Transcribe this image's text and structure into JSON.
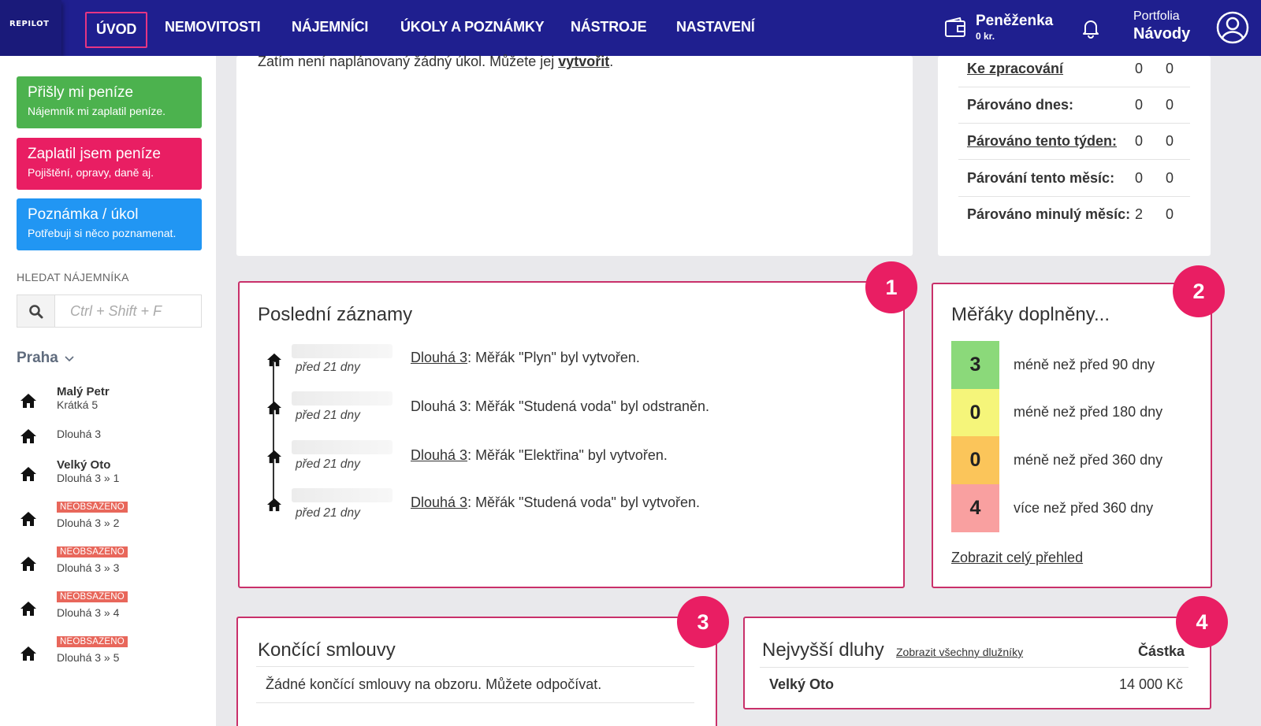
{
  "nav": {
    "logo": "REPILOT",
    "items": [
      "ÚVOD",
      "NEMOVITOSTI",
      "NÁJEMNÍCI",
      "ÚKOLY A POZNÁMKY",
      "NÁSTROJE",
      "NASTAVENÍ"
    ],
    "wallet_label": "Peněženka",
    "wallet_amount": "0 kr.",
    "portfolio_label": "Portfolia",
    "guides_label": "Návody"
  },
  "sidebar": {
    "actions": [
      {
        "title": "Přišly mi peníze",
        "subtitle": "Nájemník mi zaplatil peníze.",
        "color": "#4cb24e"
      },
      {
        "title": "Zaplatil jsem peníze",
        "subtitle": "Pojištění, opravy, daně aj.",
        "color": "#e91e63"
      },
      {
        "title": "Poznámka / úkol",
        "subtitle": "Potřebuji si něco poznamenat.",
        "color": "#2196f3"
      }
    ],
    "search_label": "HLEDAT NÁJEMNÍKA",
    "search_placeholder": "Ctrl + Shift + F",
    "city": "Praha",
    "tenants": [
      {
        "name": "Malý Petr",
        "address": "Krátká 5",
        "badge": ""
      },
      {
        "name": "",
        "address": "Dlouhá 3",
        "badge": ""
      },
      {
        "name": "Velký Oto",
        "address": "Dlouhá 3 » 1",
        "badge": ""
      },
      {
        "name": "",
        "address": "Dlouhá 3 » 2",
        "badge": "NEOBSAZENO"
      },
      {
        "name": "",
        "address": "Dlouhá 3 » 3",
        "badge": "NEOBSAZENO"
      },
      {
        "name": "",
        "address": "Dlouhá 3 » 4",
        "badge": "NEOBSAZENO"
      },
      {
        "name": "",
        "address": "Dlouhá 3 » 5",
        "badge": "NEOBSAZENO"
      }
    ]
  },
  "tasks": {
    "text": "Zatím není naplánovaný žádný úkol. Můžete jej ",
    "link": "vytvořit",
    "end": "."
  },
  "stats": [
    {
      "label": "Ke zpracování",
      "v1": "0",
      "v2": "0",
      "link": true
    },
    {
      "label": "Párováno dnes:",
      "v1": "0",
      "v2": "0",
      "link": false
    },
    {
      "label": "Párováno tento týden:",
      "v1": "0",
      "v2": "0",
      "link": true
    },
    {
      "label": "Párování tento měsíc:",
      "v1": "0",
      "v2": "0",
      "link": false
    },
    {
      "label": "Párováno minulý měsíc:",
      "v1": "2",
      "v2": "0",
      "link": false
    }
  ],
  "recent": {
    "number": "1",
    "title": "Poslední záznamy",
    "items": [
      {
        "date": "před 21 dny",
        "link": "Dlouhá 3",
        "text": ": Měřák \"Plyn\" byl vytvořen."
      },
      {
        "date": "před 21 dny",
        "link": "",
        "text": "Dlouhá 3: Měřák \"Studená voda\" byl odstraněn."
      },
      {
        "date": "před 21 dny",
        "link": "Dlouhá 3",
        "text": ": Měřák \"Elektřina\" byl vytvořen."
      },
      {
        "date": "před 21 dny",
        "link": "Dlouhá 3",
        "text": ": Měřák \"Studená voda\" byl vytvořen."
      }
    ]
  },
  "meters": {
    "number": "2",
    "title": "Měřáky doplněny...",
    "rows": [
      {
        "count": "3",
        "label": "méně než před 90 dny",
        "color": "#8bd97a"
      },
      {
        "count": "0",
        "label": "méně než před 180 dny",
        "color": "#f5f57a"
      },
      {
        "count": "0",
        "label": "méně než před 360 dny",
        "color": "#fbc55a"
      },
      {
        "count": "4",
        "label": "více než před 360 dny",
        "color": "#f9a0a0"
      }
    ],
    "link": "Zobrazit celý přehled"
  },
  "contracts": {
    "number": "3",
    "title": "Končící smlouvy",
    "text": "Žádné končící smlouvy na obzoru. Můžete odpočívat."
  },
  "debts": {
    "number": "4",
    "title": "Nejvyšší dluhy",
    "link": "Zobrazit všechny dlužníky",
    "col": "Částka",
    "rows": [
      {
        "name": "Velký Oto",
        "amount": "14 000 Kč"
      }
    ]
  }
}
